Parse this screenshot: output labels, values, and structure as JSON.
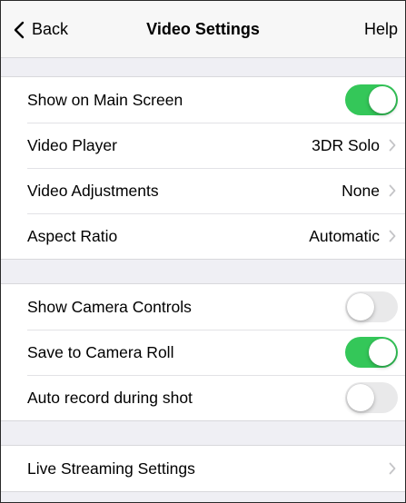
{
  "nav": {
    "back_label": "Back",
    "title": "Video Settings",
    "help_label": "Help"
  },
  "groups": [
    {
      "rows": [
        {
          "label": "Show on Main Screen",
          "type": "toggle",
          "on": true
        },
        {
          "label": "Video Player",
          "type": "disclosure",
          "value": "3DR Solo"
        },
        {
          "label": "Video Adjustments",
          "type": "disclosure",
          "value": "None"
        },
        {
          "label": "Aspect Ratio",
          "type": "disclosure",
          "value": "Automatic"
        }
      ]
    },
    {
      "rows": [
        {
          "label": "Show Camera Controls",
          "type": "toggle",
          "on": false
        },
        {
          "label": "Save to Camera Roll",
          "type": "toggle",
          "on": true
        },
        {
          "label": "Auto record during shot",
          "type": "toggle",
          "on": false
        }
      ]
    },
    {
      "rows": [
        {
          "label": "Live Streaming Settings",
          "type": "disclosure",
          "value": ""
        }
      ]
    }
  ],
  "colors": {
    "toggle_on": "#34c759",
    "toggle_off": "#e9e9ea",
    "background": "#efeff4"
  },
  "icons": {
    "back": "chevron-left-icon",
    "disclosure": "chevron-right-icon"
  }
}
